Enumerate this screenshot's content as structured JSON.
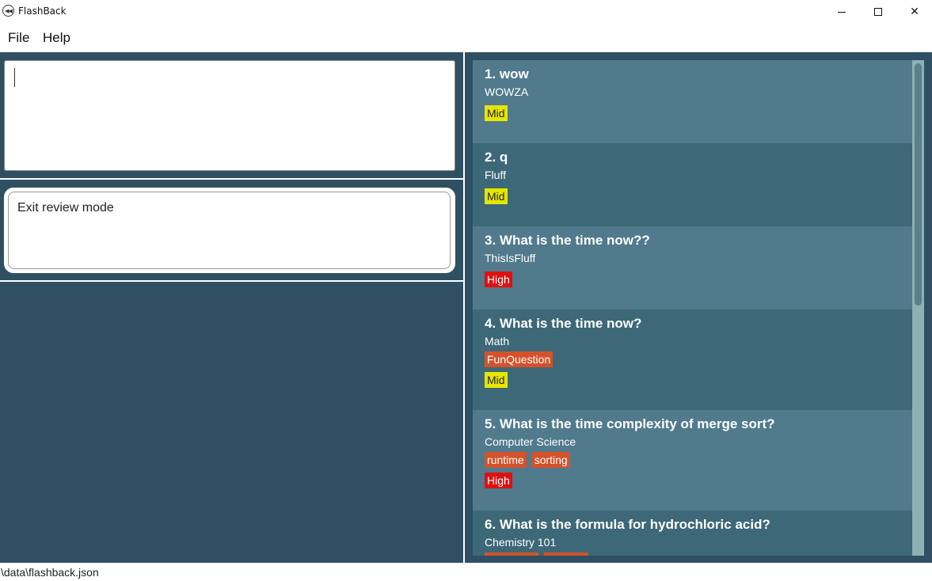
{
  "window": {
    "title": "FlashBack",
    "icon": "rewind-circle-icon"
  },
  "menu": {
    "file": "File",
    "help": "Help"
  },
  "command_box": {
    "value": ""
  },
  "result_display": {
    "text": "Exit review mode"
  },
  "cards": [
    {
      "index": "1.",
      "question": "wow",
      "category": "WOWZA",
      "tags": [],
      "priority": "Mid"
    },
    {
      "index": "2.",
      "question": "q",
      "category": "Fluff",
      "tags": [],
      "priority": "Mid"
    },
    {
      "index": "3.",
      "question": "What is the time now??",
      "category": "ThisIsFluff",
      "tags": [],
      "priority": "High"
    },
    {
      "index": "4.",
      "question": "What is the time now?",
      "category": "Math",
      "tags": [
        "FunQuestion"
      ],
      "priority": "Mid"
    },
    {
      "index": "5.",
      "question": "What is the time complexity of merge sort?",
      "category": "Computer Science",
      "tags": [
        "runtime",
        "sorting"
      ],
      "priority": "High"
    },
    {
      "index": "6.",
      "question": "What is the formula for hydrochloric acid?",
      "category": "Chemistry 101",
      "tags": [],
      "priority": ""
    }
  ],
  "status_bar": {
    "path": "\\data\\flashback.json"
  },
  "colors": {
    "background": "#2f5062",
    "card_odd": "#517a8d",
    "card_even": "#3d6878",
    "tag": "#d4522a",
    "mid": "#e6e600",
    "high": "#e01010"
  }
}
